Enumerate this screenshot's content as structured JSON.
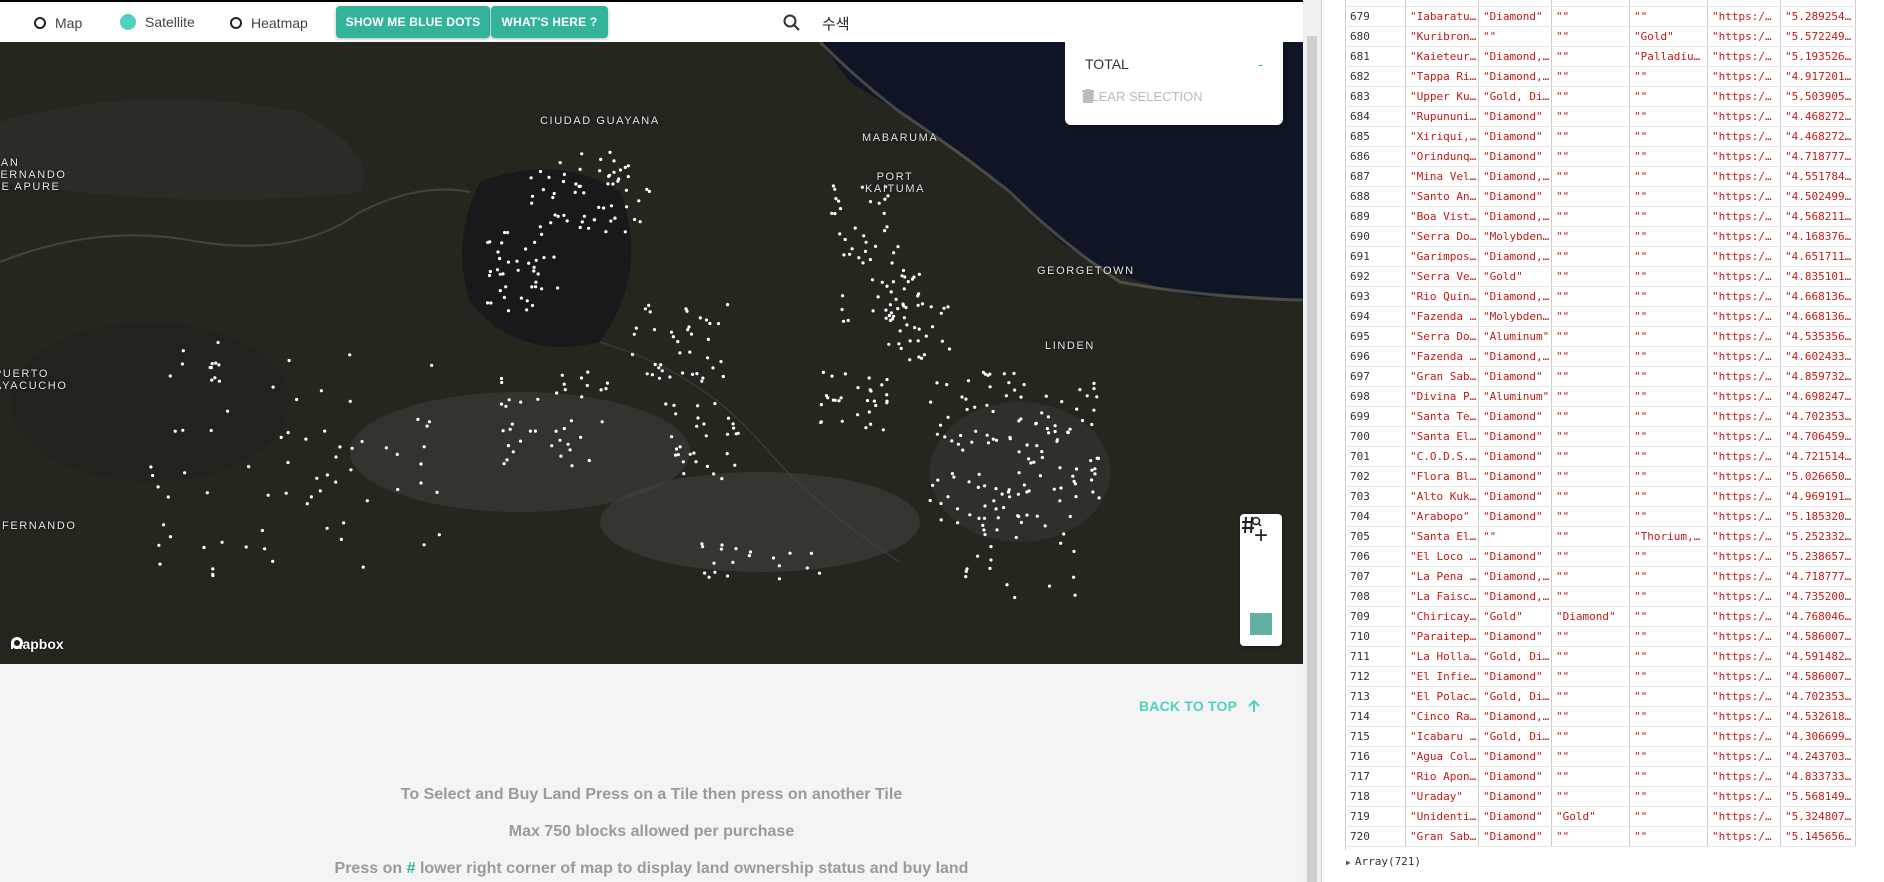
{
  "topbar": {
    "radios": [
      {
        "label": "Map",
        "selected": false
      },
      {
        "label": "Satellite",
        "selected": true
      },
      {
        "label": "Heatmap",
        "selected": false
      }
    ],
    "btn_blue_dots": "SHOW ME BLUE DOTS",
    "btn_whats_here": "WHAT'S HERE ?",
    "search_value": "수색",
    "accent": "#33b39a"
  },
  "map": {
    "cities": [
      "CIUDAD GUAYANA",
      "MABARUMA",
      "PORT KAITUMA",
      "GEORGETOWN",
      "LINDEN",
      "SAN FERNANDO DE APURE",
      "PUERTO AYACUCHO",
      "FERNANDO"
    ],
    "attribution": "mapbox",
    "total_label": "TOTAL",
    "total_value": "-",
    "clear_label": "CLEAR SELECTION",
    "zoom_in": "+",
    "grid_icon": "grid-search-icon",
    "zoom_out": "—"
  },
  "back_to_top": "BACK TO TOP",
  "instructions": {
    "line1": "To Select and Buy Land Press on a Tile then press on another Tile",
    "line2": "Max 750 blocks allowed per purchase",
    "line3_before": "Press on",
    "line3_hash": "#",
    "line3_after": "lower right corner of map to display land ownership status and buy land"
  },
  "console": {
    "rows": [
      [
        "679",
        "\"Iabaratu…",
        "\"Diamond\"",
        "\"\"",
        "\"\"",
        "\"https:/…",
        "\"5.289254…"
      ],
      [
        "680",
        "\"Kuribron…",
        "\"\"",
        "\"\"",
        "\"Gold\"",
        "\"https:/…",
        "\"5.572249…"
      ],
      [
        "681",
        "\"Kaieteur…",
        "\"Diamond,…",
        "\"\"",
        "\"Palladiu…",
        "\"https:/…",
        "\"5.193526…"
      ],
      [
        "682",
        "\"Tappa Ri…",
        "\"Diamond,…",
        "\"\"",
        "\"\"",
        "\"https:/…",
        "\"4.917201…"
      ],
      [
        "683",
        "\"Upper Ku…",
        "\"Gold, Di…",
        "\"\"",
        "\"\"",
        "\"https:/…",
        "\"5.503905…"
      ],
      [
        "684",
        "\"Rupununi…",
        "\"Diamond\"",
        "\"\"",
        "\"\"",
        "\"https:/…",
        "\"4.468272…"
      ],
      [
        "685",
        "\"Xiriqui,…",
        "\"Diamond\"",
        "\"\"",
        "\"\"",
        "\"https:/…",
        "\"4.468272…"
      ],
      [
        "686",
        "\"Orindunq…",
        "\"Diamond\"",
        "\"\"",
        "\"\"",
        "\"https:/…",
        "\"4.718777…"
      ],
      [
        "687",
        "\"Mina Vel…",
        "\"Diamond,…",
        "\"\"",
        "\"\"",
        "\"https:/…",
        "\"4.551784…"
      ],
      [
        "688",
        "\"Santo An…",
        "\"Diamond\"",
        "\"\"",
        "\"\"",
        "\"https:/…",
        "\"4.502499…"
      ],
      [
        "689",
        "\"Boa Vist…",
        "\"Diamond,…",
        "\"\"",
        "\"\"",
        "\"https:/…",
        "\"4.568211…"
      ],
      [
        "690",
        "\"Serra Do…",
        "\"Molybden…",
        "\"\"",
        "\"\"",
        "\"https:/…",
        "\"4.168376…"
      ],
      [
        "691",
        "\"Garimpos…",
        "\"Diamond,…",
        "\"\"",
        "\"\"",
        "\"https:/…",
        "\"4.651711…"
      ],
      [
        "692",
        "\"Serra Ve…",
        "\"Gold\"",
        "\"\"",
        "\"\"",
        "\"https:/…",
        "\"4.835101…"
      ],
      [
        "693",
        "\"Rio Quin…",
        "\"Diamond,…",
        "\"\"",
        "\"\"",
        "\"https:/…",
        "\"4.668136…"
      ],
      [
        "694",
        "\"Fazenda …",
        "\"Molybden…",
        "\"\"",
        "\"\"",
        "\"https:/…",
        "\"4.668136…"
      ],
      [
        "695",
        "\"Serra Do…",
        "\"Aluminum\"",
        "\"\"",
        "\"\"",
        "\"https:/…",
        "\"4.535356…"
      ],
      [
        "696",
        "\"Fazenda …",
        "\"Diamond,…",
        "\"\"",
        "\"\"",
        "\"https:/…",
        "\"4.602433…"
      ],
      [
        "697",
        "\"Gran Sab…",
        "\"Diamond\"",
        "\"\"",
        "\"\"",
        "\"https:/…",
        "\"4.859732…"
      ],
      [
        "698",
        "\"Divina P…",
        "\"Aluminum\"",
        "\"\"",
        "\"\"",
        "\"https:/…",
        "\"4.698247…"
      ],
      [
        "699",
        "\"Santa Te…",
        "\"Diamond\"",
        "\"\"",
        "\"\"",
        "\"https:/…",
        "\"4.702353…"
      ],
      [
        "700",
        "\"Santa El…",
        "\"Diamond\"",
        "\"\"",
        "\"\"",
        "\"https:/…",
        "\"4.706459…"
      ],
      [
        "701",
        "\"C.O.D.S.…",
        "\"Diamond\"",
        "\"\"",
        "\"\"",
        "\"https:/…",
        "\"4.721514…"
      ],
      [
        "702",
        "\"Flora Bl…",
        "\"Diamond\"",
        "\"\"",
        "\"\"",
        "\"https:/…",
        "\"5.026650…"
      ],
      [
        "703",
        "\"Alto Kuk…",
        "\"Diamond\"",
        "\"\"",
        "\"\"",
        "\"https:/…",
        "\"4.969191…"
      ],
      [
        "704",
        "\"Arabopo\"",
        "\"Diamond\"",
        "\"\"",
        "\"\"",
        "\"https:/…",
        "\"5.185320…"
      ],
      [
        "705",
        "\"Santa El…",
        "\"\"",
        "\"\"",
        "\"Thorium,…",
        "\"https:/…",
        "\"5.252332…"
      ],
      [
        "706",
        "\"El Loco …",
        "\"Diamond\"",
        "\"\"",
        "\"\"",
        "\"https:/…",
        "\"5.238657…"
      ],
      [
        "707",
        "\"La Pena …",
        "\"Diamond,…",
        "\"\"",
        "\"\"",
        "\"https:/…",
        "\"4.718777…"
      ],
      [
        "708",
        "\"La Faisc…",
        "\"Diamond,…",
        "\"\"",
        "\"\"",
        "\"https:/…",
        "\"4.735200…"
      ],
      [
        "709",
        "\"Chiricay…",
        "\"Gold\"",
        "\"Diamond\"",
        "\"\"",
        "\"https:/…",
        "\"4.768046…"
      ],
      [
        "710",
        "\"Paraitep…",
        "\"Diamond\"",
        "\"\"",
        "\"\"",
        "\"https:/…",
        "\"4.586007…"
      ],
      [
        "711",
        "\"La Holla…",
        "\"Gold, Di…",
        "\"\"",
        "\"\"",
        "\"https:/…",
        "\"4.591482…"
      ],
      [
        "712",
        "\"El Infie…",
        "\"Diamond\"",
        "\"\"",
        "\"\"",
        "\"https:/…",
        "\"4.586007…"
      ],
      [
        "713",
        "\"El Polac…",
        "\"Gold, Di…",
        "\"\"",
        "\"\"",
        "\"https:/…",
        "\"4.702353…"
      ],
      [
        "714",
        "\"Cinco Ra…",
        "\"Diamond,…",
        "\"\"",
        "\"\"",
        "\"https:/…",
        "\"4.532618…"
      ],
      [
        "715",
        "\"Icabaru …",
        "\"Gold, Di…",
        "\"\"",
        "\"\"",
        "\"https:/…",
        "\"4.306699…"
      ],
      [
        "716",
        "\"Agua Col…",
        "\"Diamond\"",
        "\"\"",
        "\"\"",
        "\"https:/…",
        "\"4.243703…"
      ],
      [
        "717",
        "\"Rio Apon…",
        "\"Diamond\"",
        "\"\"",
        "\"\"",
        "\"https:/…",
        "\"4.833733…"
      ],
      [
        "718",
        "\"Uraday\"",
        "\"Diamond\"",
        "\"\"",
        "\"\"",
        "\"https:/…",
        "\"5.568149…"
      ],
      [
        "719",
        "\"Unidenti…",
        "\"Diamond\"",
        "\"Gold\"",
        "\"\"",
        "\"https:/…",
        "\"5.324807…"
      ],
      [
        "720",
        "\"Gran Sab…",
        "\"Diamond\"",
        "\"\"",
        "\"\"",
        "\"https:/…",
        "\"5.145656…"
      ]
    ],
    "array_label": "Array(721)"
  }
}
